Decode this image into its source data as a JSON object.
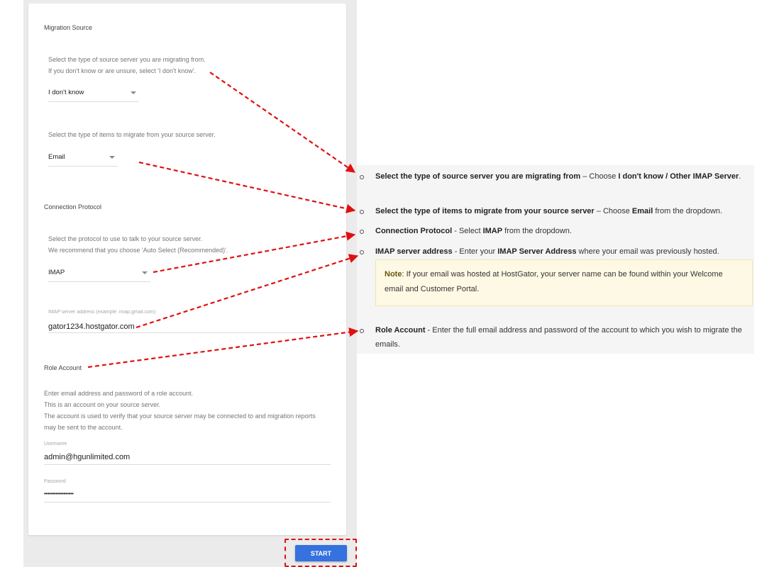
{
  "form": {
    "migration_source": {
      "title": "Migration Source",
      "help_line1": "Select the type of source server you are migrating from.",
      "help_line2": "If you don't know or are unsure, select 'I don't know'.",
      "server_type_value": "I don't know",
      "items_help": "Select the type of items to migrate from your source server.",
      "items_value": "Email"
    },
    "connection_protocol": {
      "title": "Connection Protocol",
      "help_line1": "Select the protocol to use to talk to your source server.",
      "help_line2": "We recommend that you choose 'Auto Select (Recommended)'.",
      "protocol_value": "IMAP",
      "server_label": "IMAP server address (example: imap.gmail.com)",
      "server_value": "gator1234.hostgator.com"
    },
    "role_account": {
      "title": "Role Account",
      "help_line1": "Enter email address and password of a role account.",
      "help_line2": "This is an account on your source server.",
      "help_line3": "The account is used to verify that your source server may be connected to and migration reports",
      "help_line4": "may be sent to the account.",
      "username_label": "Username",
      "username_value": "admin@hgunlimited.com",
      "password_label": "Password",
      "password_value": "••••••••••••••••••"
    },
    "start_label": "START"
  },
  "instructions": {
    "item1": {
      "bold": "Select the type of source server you are migrating from",
      "text": " – Choose ",
      "bold2": "I don't know / Other IMAP Server",
      "tail": "."
    },
    "item2": {
      "bold": "Select the type of items to migrate from your source server",
      "text": " – Choose ",
      "bold2": "Email",
      "tail": " from the dropdown."
    },
    "item3": {
      "bold": "Connection Protocol",
      "text": " - Select ",
      "bold2": "IMAP",
      "tail": " from the dropdown."
    },
    "item4": {
      "bold": "IMAP server address",
      "text": " - Enter your ",
      "bold2": "IMAP Server Address",
      "tail": " where your email was previously hosted."
    },
    "note": {
      "bold": "Note",
      "text": ": If your email was hosted at HostGator, your server name can be found within your Welcome email and Customer Portal."
    },
    "item5": {
      "bold": "Role Account",
      "text": " - Enter the full email address and password of the account to which you wish to migrate the emails."
    }
  },
  "colors": {
    "annotation": "#e01010",
    "start_button": "#3571df",
    "note_background": "#fef9e4"
  }
}
